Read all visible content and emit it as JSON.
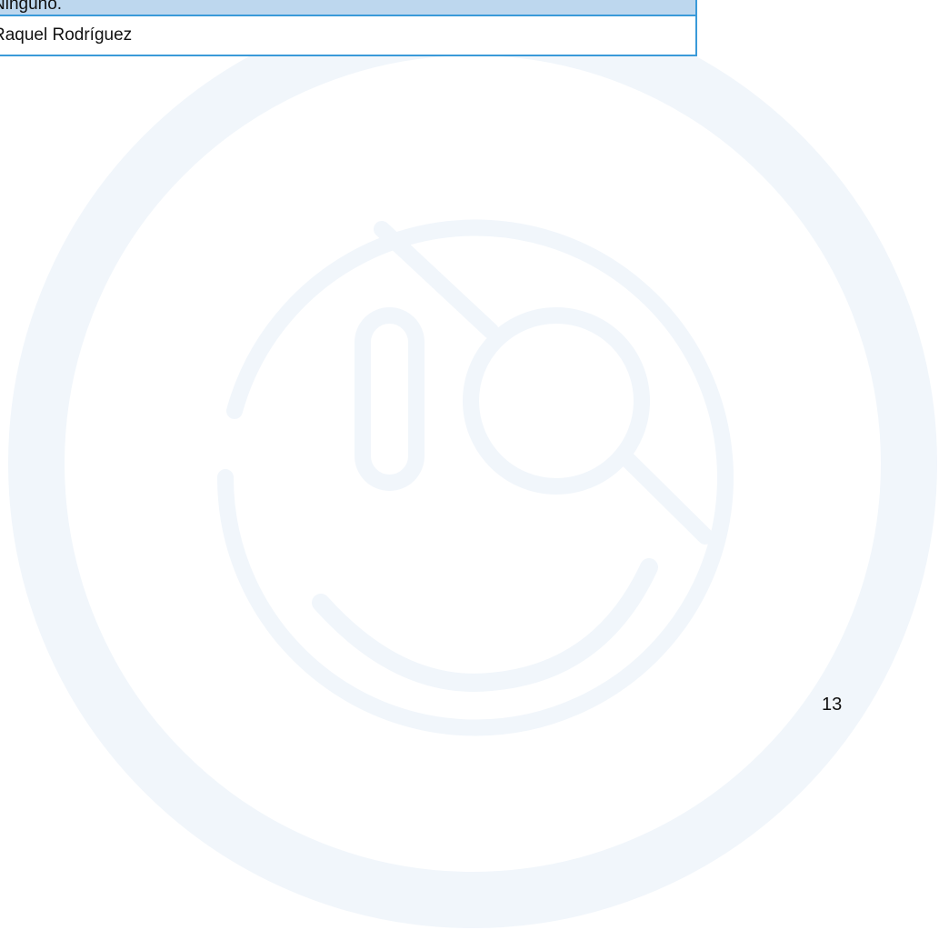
{
  "table": {
    "header_cell": "Ninguno.",
    "body_cell": "Raquel Rodríguez"
  },
  "footer": {
    "page_number": "13"
  },
  "watermark": {
    "icon": "smiley-magnifier-logo",
    "color": "#f1f6fb"
  },
  "colors": {
    "table_border": "#3a9ad9",
    "table_header_bg": "#bdd7ee"
  }
}
